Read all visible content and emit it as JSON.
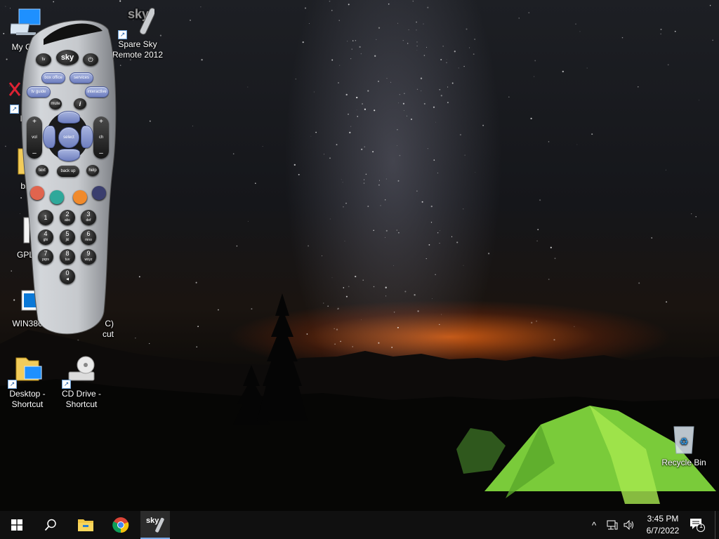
{
  "desktop": {
    "icons": [
      {
        "label": "My Com",
        "icon": "computer-icon"
      },
      {
        "label": "Spare Sky\nRemote 2012",
        "icon": "sky-remote-icon"
      },
      {
        "label": "Data",
        "icon": "data-icon"
      },
      {
        "label": "blen",
        "icon": "folder-icon"
      },
      {
        "label": "GPL-",
        "icon": "document-icon"
      },
      {
        "label": "WIN386",
        "icon": "program-icon"
      },
      {
        "label": "C)\ncut",
        "icon": "shortcut-icon"
      },
      {
        "label": "Desktop -\nShortcut",
        "icon": "desktop-folder-icon"
      },
      {
        "label": "CD Drive -\nShortcut",
        "icon": "cd-drive-icon"
      },
      {
        "label": "Recycle Bin",
        "icon": "recycle-bin-icon"
      }
    ]
  },
  "remote": {
    "brand": "sky",
    "top_buttons": {
      "tv": "tv",
      "sky": "sky",
      "power": "⏻"
    },
    "row2": {
      "box_office": "box office",
      "services": "services"
    },
    "row3": {
      "tv_guide": "tv guide",
      "interactive": "interactive"
    },
    "row4": {
      "mute": "mute",
      "info": "i"
    },
    "nav": {
      "select": "select",
      "vol": "vol",
      "ch": "ch",
      "plus": "+",
      "minus": "–"
    },
    "row5": {
      "text": "text",
      "back_up": "back up",
      "help": "help"
    },
    "color_keys": {
      "red": "#e0644e",
      "green": "#2fa89a",
      "yellow": "#f08a2c",
      "blue": "#3a3e6e"
    },
    "numbers": [
      {
        "n": "1",
        "s": ""
      },
      {
        "n": "2",
        "s": "abc"
      },
      {
        "n": "3",
        "s": "def"
      },
      {
        "n": "4",
        "s": "ghi"
      },
      {
        "n": "5",
        "s": "jkl"
      },
      {
        "n": "6",
        "s": "mno"
      },
      {
        "n": "7",
        "s": "pqrs"
      },
      {
        "n": "8",
        "s": "tuv"
      },
      {
        "n": "9",
        "s": "wxyz"
      },
      {
        "n": "0",
        "s": "◀"
      }
    ]
  },
  "taskbar": {
    "start": "start-icon",
    "search": "search-icon",
    "pinned": [
      "file-explorer-icon",
      "chrome-icon",
      "sky-remote-icon"
    ],
    "tray": {
      "chevron": "^",
      "network": "network-icon",
      "volume": "volume-icon"
    },
    "clock": {
      "time": "3:45 PM",
      "date": "6/7/2022"
    },
    "notifications": {
      "count": "1"
    }
  },
  "colors": {
    "taskbar": "#101010",
    "remote_body": "#c9ccd0",
    "remote_accent": "#7f8fce"
  }
}
